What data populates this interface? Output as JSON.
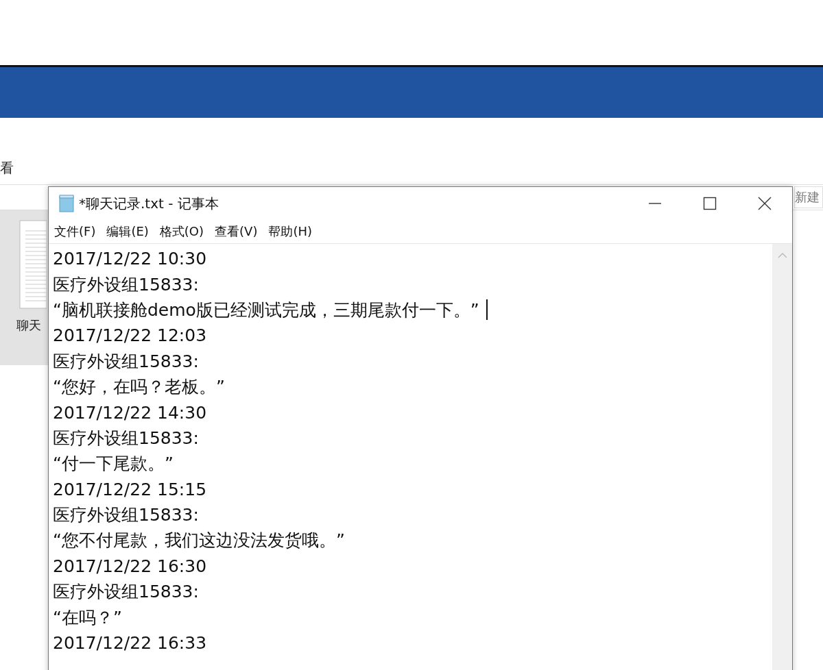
{
  "explorer": {
    "menu_text": "看",
    "toolbar_right": "新建",
    "file_label": "聊天"
  },
  "notepad": {
    "title": "*聊天记录.txt - 记事本",
    "menu": [
      "文件(F)",
      "编辑(E)",
      "格式(O)",
      "查看(V)",
      "帮助(H)"
    ],
    "lines": [
      {
        "text": "2017/12/22  10:30",
        "cursor": false
      },
      {
        "text": "医疗外设组15833:",
        "cursor": false
      },
      {
        "text": "“脑机联接舱demo版已经测试完成，三期尾款付一下。”",
        "cursor": true
      },
      {
        "text": "2017/12/22  12:03",
        "cursor": false
      },
      {
        "text": "医疗外设组15833:",
        "cursor": false
      },
      {
        "text": "“您好，在吗？老板。”",
        "cursor": false
      },
      {
        "text": "2017/12/22  14:30",
        "cursor": false
      },
      {
        "text": "医疗外设组15833:",
        "cursor": false
      },
      {
        "text": "“付一下尾款。”",
        "cursor": false
      },
      {
        "text": "2017/12/22  15:15",
        "cursor": false
      },
      {
        "text": "医疗外设组15833:",
        "cursor": false
      },
      {
        "text": "“您不付尾款，我们这边没法发货哦。”",
        "cursor": false
      },
      {
        "text": "2017/12/22  16:30",
        "cursor": false
      },
      {
        "text": "医疗外设组15833:",
        "cursor": false
      },
      {
        "text": "“在吗？”",
        "cursor": false
      },
      {
        "text": "2017/12/22  16:33",
        "cursor": false
      }
    ]
  }
}
